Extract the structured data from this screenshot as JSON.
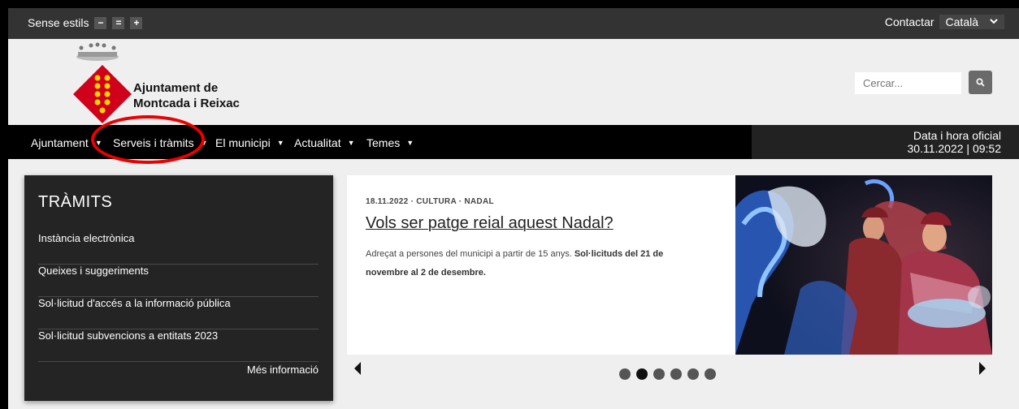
{
  "utilbar": {
    "styles_label": "Sense estils",
    "size_buttons": [
      "−",
      "=",
      "+"
    ],
    "contact_label": "Contactar",
    "language_selected": "Català"
  },
  "header": {
    "brand_line1": "Ajuntament de",
    "brand_line2": "Montcada i Reixac",
    "search_placeholder": "Cercar..."
  },
  "nav": {
    "items": [
      {
        "label": "Ajuntament"
      },
      {
        "label": "Serveis i tràmits"
      },
      {
        "label": "El municipi"
      },
      {
        "label": "Actualitat"
      },
      {
        "label": "Temes"
      }
    ],
    "clock_label": "Data i hora oficial",
    "clock_value": "30.11.2022 | 09:52"
  },
  "tramits": {
    "title": "TRÀMITS",
    "items": [
      "Instància electrònica",
      "Queixes i suggeriments",
      "Sol·licitud d'accés a la informació pública",
      "Sol·licitud subvencions a entitats 2023"
    ],
    "more_label": "Més informació"
  },
  "news": {
    "meta": "18.11.2022 · CULTURA · NADAL",
    "title": "Vols ser patge reial aquest Nadal?",
    "desc_plain": "Adreçat a persones del municipi a partir de 15 anys. ",
    "desc_bold": "Sol·licituds del 21 de novembre al 2 de desembre."
  },
  "carousel": {
    "dot_count": 6,
    "active_index": 1
  },
  "colors": {
    "accent_red": "#e00000",
    "shield_red": "#d0021b",
    "shield_yellow": "#ffd400",
    "nav_bg": "#000000"
  }
}
